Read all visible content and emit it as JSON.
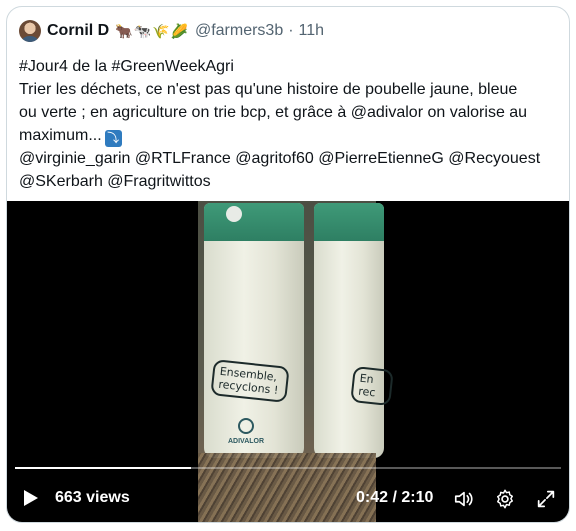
{
  "tweet": {
    "author_name": "Cornil D",
    "author_emojis": "🐂🐄🌾🌽",
    "handle": "@farmers3b",
    "separator": "·",
    "time": "11h",
    "lines": [
      "#Jour4 de la #GreenWeekAgri",
      "Trier les déchets, ce n'est pas qu'une histoire de poubelle jaune, bleue",
      "ou verte ; en agriculture on trie bcp, et grâce à @adivalor on valorise au",
      "maximum..."
    ],
    "arrow_emoji": "⤵",
    "mentions_line1": "@virginie_garin @RTLFrance @agritof60 @PierreEtienneG @Recyouest",
    "mentions_line2": "@SKerbarh @Fragritwittos"
  },
  "video": {
    "bag_left_print": "Ensemble, recyclons !",
    "bag_left_brand": "ADIVALOR",
    "bag_right_print": "En rec",
    "views": "663 views",
    "timecode": "0:42 / 2:10",
    "progress_fraction": 0.323,
    "icons": [
      "play-icon",
      "volume-icon",
      "settings-icon",
      "fullscreen-icon"
    ]
  }
}
